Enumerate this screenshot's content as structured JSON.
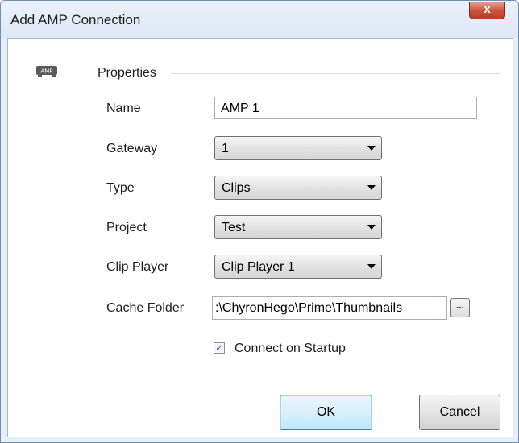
{
  "window": {
    "title": "Add AMP Connection"
  },
  "titlebar": {
    "close_glyph": "x"
  },
  "section": {
    "icon": "amp-device-icon",
    "icon_text": "AMP",
    "title": "Properties"
  },
  "fields": {
    "name": {
      "label": "Name",
      "value": "AMP 1"
    },
    "gateway": {
      "label": "Gateway",
      "value": "1"
    },
    "type": {
      "label": "Type",
      "value": "Clips"
    },
    "project": {
      "label": "Project",
      "value": "Test"
    },
    "clip_player": {
      "label": "Clip Player",
      "value": "Clip Player 1"
    },
    "cache_folder": {
      "label": "Cache Folder",
      "value": ":\\ChyronHego\\Prime\\Thumbnails",
      "browse_label": "..."
    }
  },
  "connect_on_startup": {
    "label": "Connect on Startup",
    "checked": true,
    "check_glyph": "✓"
  },
  "buttons": {
    "ok": "OK",
    "cancel": "Cancel"
  }
}
